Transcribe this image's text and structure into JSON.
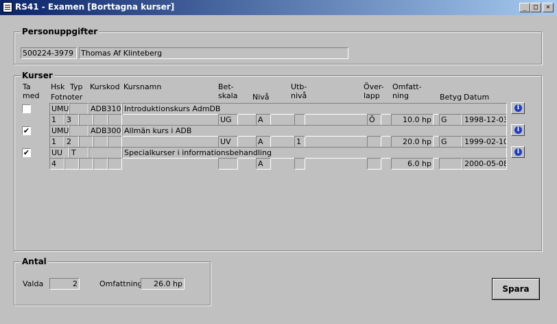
{
  "window": {
    "title": "RS41 - Examen [Borttagna kurser]",
    "controls": [
      "_",
      "□",
      "×"
    ]
  },
  "person": {
    "legend": "Personuppgifter",
    "id": "500224-3979",
    "name": "Thomas Af Klinteberg"
  },
  "kurser": {
    "legend": "Kurser",
    "headers": {
      "ta_med_1": "Ta",
      "ta_med_2": "med",
      "hsk": "Hsk",
      "typ": "Typ",
      "fotnoter": "Fotnoter",
      "kurskod": "Kurskod",
      "kursnamn": "Kursnamn",
      "betskala_1": "Bet-",
      "betskala_2": "skala",
      "niva": "Nivå",
      "utbniva_1": "Utb-",
      "utbniva_2": "nivå",
      "overlapp_1": "Över-",
      "overlapp_2": "lapp",
      "omfattning_1": "Omfatt-",
      "omfattning_2": "ning",
      "betyg": "Betyg",
      "datum": "Datum"
    },
    "rows": [
      {
        "checked": false,
        "hsk": "UMU",
        "typ": "",
        "kurskod": "ADB310",
        "kursnamn": "Introduktionskurs AdmDB",
        "fot1": "1",
        "fot2": "3",
        "betskala": "UG",
        "niva": "A",
        "utbniva": "",
        "overlapp": "Ö",
        "omfattning": "10.0 hp",
        "betyg": "G",
        "datum": "1998-12-03"
      },
      {
        "checked": true,
        "hsk": "UMU",
        "typ": "",
        "kurskod": "ADB300",
        "kursnamn": "Allmän kurs i ADB",
        "fot1": "1",
        "fot2": "2",
        "betskala": "UV",
        "niva": "A",
        "utbniva": "1",
        "overlapp": "",
        "omfattning": "20.0 hp",
        "betyg": "G",
        "datum": "1999-02-10"
      },
      {
        "checked": true,
        "hsk": "UU",
        "typ": "T",
        "kurskod": "",
        "kursnamn": "Specialkurser i informationsbehandling",
        "fot1": "4",
        "fot2": "",
        "betskala": "",
        "niva": "A",
        "utbniva": "",
        "overlapp": "",
        "omfattning": "6.0 hp",
        "betyg": "",
        "datum": "2000-05-08"
      }
    ],
    "checkmark": "✔",
    "info_glyph": "i"
  },
  "antal": {
    "legend": "Antal",
    "valda_label": "Valda",
    "valda_value": "2",
    "omfattning_label": "Omfattning",
    "omfattning_value": "26.0 hp"
  },
  "buttons": {
    "spara": "Spara"
  }
}
